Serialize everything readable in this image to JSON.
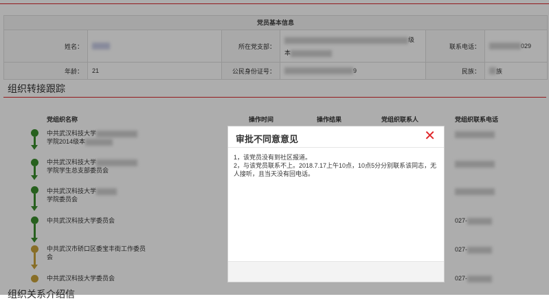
{
  "info": {
    "title": "党员基本信息",
    "name_label": "姓名：",
    "branch_label": "所在党支部：",
    "branch_value_end": "级",
    "branch_value_line2": "本",
    "phone_label": "联系电话：",
    "phone_value_end": "029",
    "age_label": "年龄：",
    "age_value": "21",
    "id_label": "公民身份证号：",
    "id_value_end": "9",
    "ethnic_label": "民族：",
    "ethnic_value_end": "族"
  },
  "tracking": {
    "title": "组织转接跟踪",
    "headers": [
      "党组织名称",
      "操作时间",
      "操作结果",
      "党组织联系人",
      "党组织联系电话"
    ],
    "rows": [
      {
        "org_line1": "中共武汉科技大学",
        "org_line2": "学院2014级本",
        "status": "done",
        "phone": ""
      },
      {
        "org_line1": "中共武汉科技大学",
        "org_line2": "学院学生总支部委员会",
        "status": "done",
        "phone": ""
      },
      {
        "org_line1": "中共武汉科技大学",
        "org_line2": "学院委员会",
        "status": "done",
        "phone": ""
      },
      {
        "org_line1": "中共武汉科技大学委员会",
        "org_line2": "",
        "status": "done",
        "phone": "027-"
      },
      {
        "org_line1": "中共武汉市硚口区委宝丰街工作委员",
        "org_line2": "会",
        "status": "pending",
        "phone": "027-"
      },
      {
        "org_line1": "中共武汉科技大学委员会",
        "org_line2": "",
        "status": "pending",
        "phone": "027-"
      }
    ]
  },
  "relation_title": "组织关系介绍信",
  "modal": {
    "title": "审批不同意意见",
    "close_icon": "close-icon",
    "line1": "1，该党员没有到社区报道。",
    "line2": "2，与该党员联系不上。2018.7.17上午10点，10点5分分别联系该同志，无人接听，且当天没有回电话。"
  },
  "colors": {
    "accent_red": "#d9262a",
    "done_green": "#3a8e2d",
    "pending_gold": "#c9a23a"
  }
}
